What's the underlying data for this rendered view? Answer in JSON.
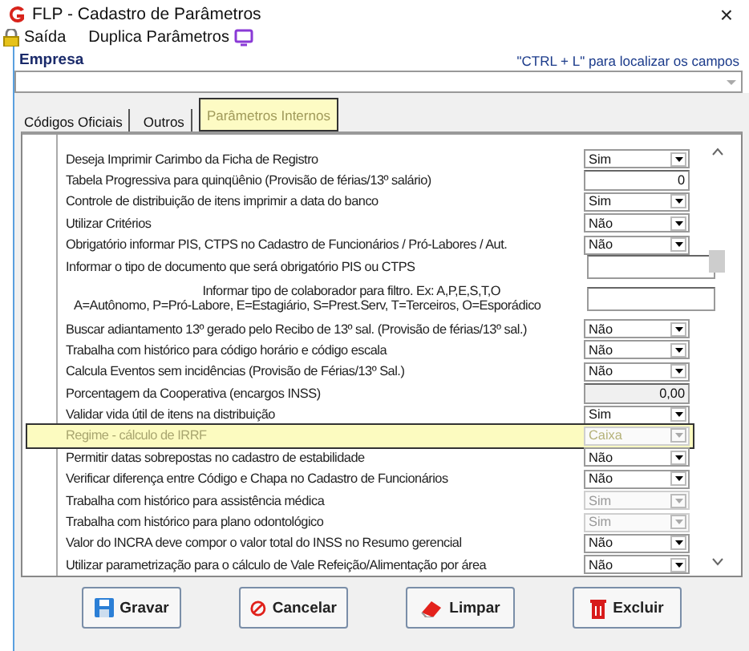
{
  "window": {
    "title": "FLP - Cadastro de Parâmetros",
    "close": "×"
  },
  "menu": [
    {
      "label": "Saída",
      "kind": "lock"
    },
    {
      "label": "Duplica Parâmetros",
      "kind": "monitor"
    }
  ],
  "empresa": {
    "label": "Empresa",
    "hint": "\"CTRL + L\" para localizar os campos"
  },
  "tabs": [
    {
      "label": "Códigos Oficiais",
      "selected": false,
      "highlighted": false
    },
    {
      "label": "Outros",
      "selected": false,
      "highlighted": false
    },
    {
      "label": "Parâmetros Internos",
      "selected": true,
      "highlighted": true
    }
  ],
  "rows": [
    {
      "label": "Deseja Imprimir Carimbo da Ficha de Registro",
      "kind": "select",
      "value": "Sim",
      "disabled": false,
      "highlighted": false
    },
    {
      "label": "Tabela Progressiva para quinqüênio (Provisão de férias/13º salário)",
      "kind": "number",
      "value": "0",
      "disabled": false,
      "highlighted": false
    },
    {
      "label": "Controle de distribuição de itens imprimir a data do banco",
      "kind": "select",
      "value": "Sim",
      "disabled": false,
      "highlighted": false
    },
    {
      "label": "Utilizar Critérios",
      "kind": "select",
      "value": "Não",
      "disabled": false,
      "highlighted": false
    },
    {
      "label": "Obrigatório informar PIS, CTPS no Cadastro de Funcionários / Pró-Labores / Aut.",
      "kind": "select",
      "value": "Não",
      "disabled": false,
      "highlighted": false
    },
    {
      "label": "Informar o tipo de documento que será obrigatório PIS ou CTPS",
      "kind": "text",
      "highlighted": false
    },
    {
      "label": "Informar tipo de colaborador para filtro. Ex: A,P,E,S,T,O",
      "label2": "A=Autônomo, P=Pró-Labore, E=Estagiário, S=Prest.Serv, T=Terceiros, O=Esporádico",
      "kind": "text",
      "highlighted": false
    },
    {
      "label": "Buscar adiantamento 13º  gerado pelo Recibo de 13º sal. (Provisão de férias/13º sal.)",
      "kind": "select",
      "value": "Não",
      "disabled": false,
      "highlighted": false
    },
    {
      "label": "Trabalha com histórico para código horário e código escala",
      "kind": "select",
      "value": "Não",
      "disabled": false,
      "highlighted": false
    },
    {
      "label": "Calcula Eventos sem incidências (Provisão de Férias/13º Sal.)",
      "kind": "select",
      "value": "Não",
      "disabled": false,
      "highlighted": false
    },
    {
      "label": "Porcentagem da Cooperativa (encargos INSS)",
      "kind": "number",
      "value": "0,00",
      "disabled": true,
      "highlighted": false
    },
    {
      "label": "Validar vida útil de itens na distribuição",
      "kind": "select",
      "value": "Sim",
      "disabled": false,
      "highlighted": false
    },
    {
      "label": "Regime - cálculo de IRRF",
      "kind": "select",
      "value": "Caixa",
      "disabled": true,
      "highlighted": true
    },
    {
      "label": "Permitir datas sobrepostas no cadastro de estabilidade",
      "kind": "select",
      "value": "Não",
      "disabled": false,
      "highlighted": false
    },
    {
      "label": "Verificar diferença entre Código e Chapa no Cadastro de Funcionários",
      "kind": "select",
      "value": "Não",
      "disabled": false,
      "highlighted": false
    },
    {
      "label": "Trabalha com histórico para assistência médica",
      "kind": "select",
      "value": "Sim",
      "disabled": true,
      "highlighted": false
    },
    {
      "label": "Trabalha com histórico para plano odontológico",
      "kind": "select",
      "value": "Sim",
      "disabled": true,
      "highlighted": false
    },
    {
      "label": "Valor do INCRA deve compor o valor total do INSS no Resumo gerencial",
      "kind": "select",
      "value": "Não",
      "disabled": false,
      "highlighted": false
    },
    {
      "label": "Utilizar parametrização para o cálculo de Vale Refeição/Alimentação por área",
      "kind": "select",
      "value": "Não",
      "disabled": false,
      "highlighted": false
    }
  ],
  "buttons": [
    {
      "label": "Gravar",
      "kind": "save"
    },
    {
      "label": "Cancelar",
      "kind": "cancel"
    },
    {
      "label": "Limpar",
      "kind": "eraser"
    },
    {
      "label": "Excluir",
      "kind": "trash"
    }
  ]
}
